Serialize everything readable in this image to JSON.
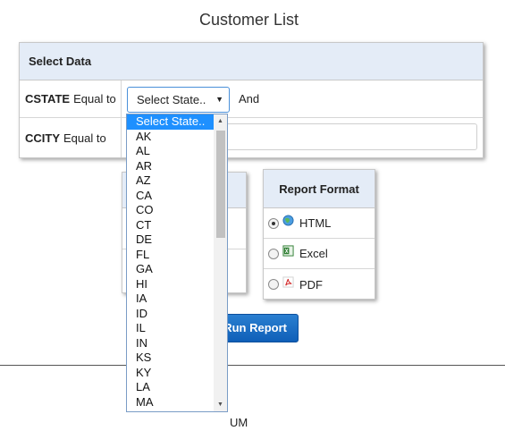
{
  "page": {
    "title": "Customer List"
  },
  "select_data": {
    "header": "Select Data",
    "state_filter": {
      "field": "CSTATE",
      "operator": "Equal to",
      "selected": "Select State..",
      "connector": "And"
    },
    "city_filter": {
      "field": "CCITY",
      "operator": "Equal to",
      "value": ""
    }
  },
  "partial_text": "UM",
  "report_format": {
    "header": "Report Format",
    "options": [
      {
        "label": "HTML",
        "checked": true,
        "icon": "html-globe-icon"
      },
      {
        "label": "Excel",
        "checked": false,
        "icon": "excel-icon"
      },
      {
        "label": "PDF",
        "checked": false,
        "icon": "pdf-icon"
      }
    ]
  },
  "run_button": {
    "label": "Run Report"
  },
  "state_dropdown": {
    "items": [
      "Select State..",
      "AK",
      "AL",
      "AR",
      "AZ",
      "CA",
      "CO",
      "CT",
      "DE",
      "FL",
      "GA",
      "HI",
      "IA",
      "ID",
      "IL",
      "IN",
      "KS",
      "KY",
      "LA",
      "MA"
    ],
    "highlighted_index": 0
  },
  "colors": {
    "header_bg": "#e4ecf7",
    "button_blue": "#0f5fb8",
    "highlight": "#1e90ff"
  }
}
